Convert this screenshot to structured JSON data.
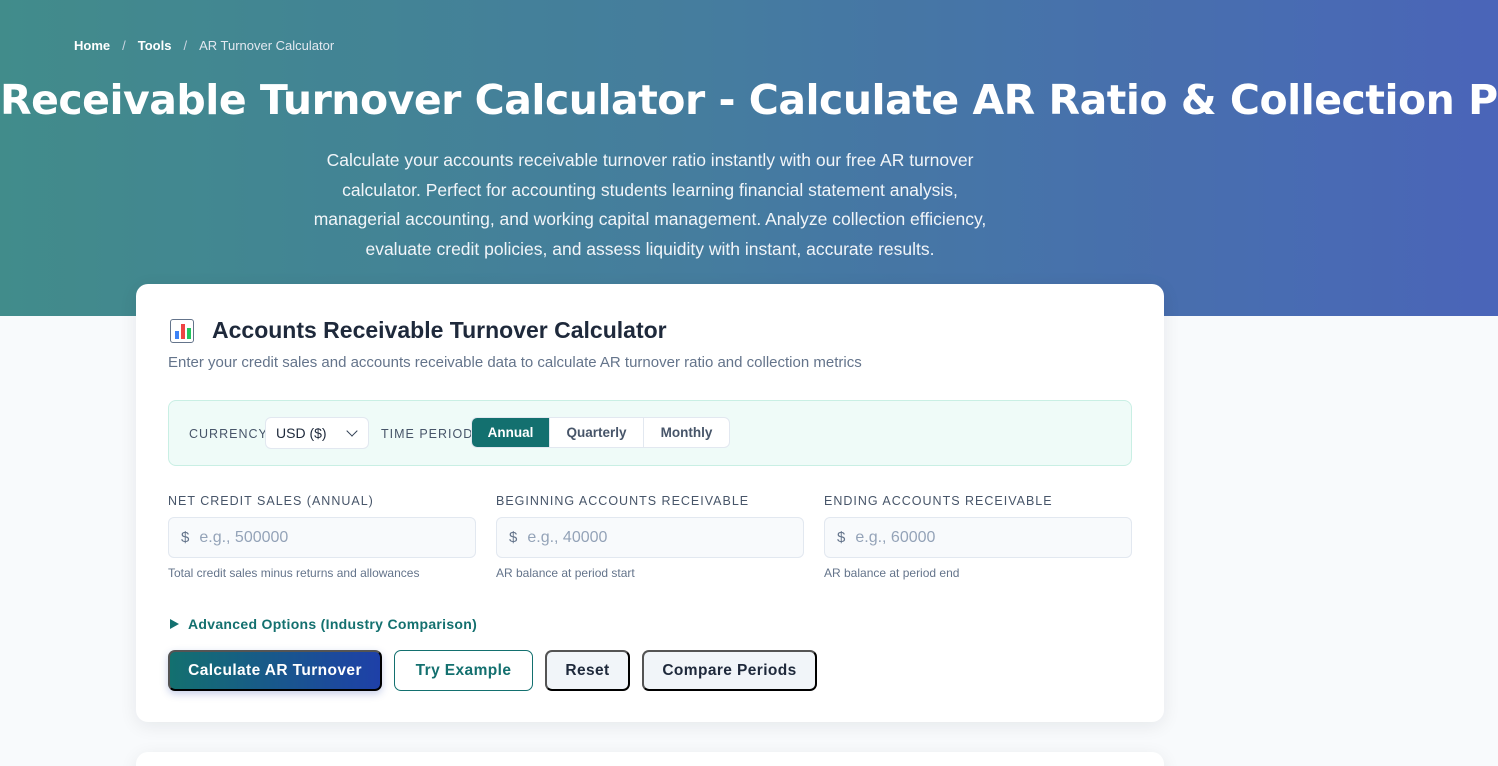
{
  "breadcrumb": {
    "home": "Home",
    "tools": "Tools",
    "current": "AR Turnover Calculator",
    "separator": "/"
  },
  "hero": {
    "title": "Receivable Turnover Calculator - Calculate AR Ratio & Collection Period",
    "description": "Calculate your accounts receivable turnover ratio instantly with our free AR turnover calculator. Perfect for accounting students learning financial statement analysis, managerial accounting, and working capital management. Analyze collection efficiency, evaluate credit policies, and assess liquidity with instant, accurate results."
  },
  "calculator": {
    "icon": "bar-chart-icon",
    "title": "Accounts Receivable Turnover Calculator",
    "subtitle": "Enter your credit sales and accounts receivable data to calculate AR turnover ratio and collection metrics",
    "settings": {
      "currency_label": "CURRENCY",
      "currency_value": "USD ($)",
      "period_label": "TIME PERIOD",
      "period_options": [
        "Annual",
        "Quarterly",
        "Monthly"
      ],
      "period_selected": "Annual"
    },
    "fields": [
      {
        "label": "NET CREDIT SALES (ANNUAL)",
        "currency": "$",
        "placeholder": "e.g., 500000",
        "value": "",
        "hint": "Total credit sales minus returns and allowances"
      },
      {
        "label": "BEGINNING ACCOUNTS RECEIVABLE",
        "currency": "$",
        "placeholder": "e.g., 40000",
        "value": "",
        "hint": "AR balance at period start"
      },
      {
        "label": "ENDING ACCOUNTS RECEIVABLE",
        "currency": "$",
        "placeholder": "e.g., 60000",
        "value": "",
        "hint": "AR balance at period end"
      }
    ],
    "advanced_toggle": "Advanced Options (Industry Comparison)",
    "buttons": {
      "calculate": "Calculate AR Turnover",
      "example": "Try Example",
      "reset": "Reset",
      "compare": "Compare Periods"
    }
  },
  "colors": {
    "brand_teal": "#13706f",
    "brand_blue": "#1e40a8",
    "settings_bg": "#effbf8"
  }
}
